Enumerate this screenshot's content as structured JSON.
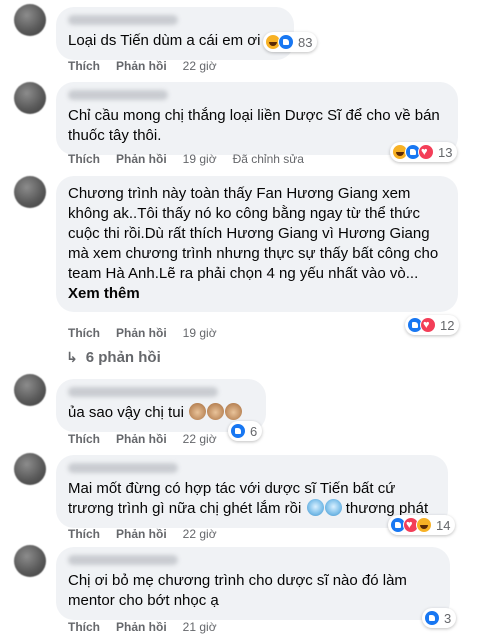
{
  "labels": {
    "like": "Thích",
    "reply": "Phản hồi",
    "see_more": "Xem thêm"
  },
  "comments": [
    {
      "text": "Loại ds Tiến dùm a cái em ơi",
      "time": "22 giờ",
      "edited": "",
      "reactions": [
        "haha",
        "like"
      ],
      "count": "83"
    },
    {
      "text": "Chỉ cầu mong chị thắng loại liền Dược Sĩ để cho về bán\nthuốc tây thôi.",
      "time": "19 giờ",
      "edited": "Đã chỉnh sửa",
      "reactions": [
        "haha",
        "like",
        "love"
      ],
      "count": "13"
    },
    {
      "text": "Chương trình này toàn thấy Fan Hương Giang xem\nkhông ak..Tôi thấy nó ko công bằng ngay từ thể thức\ncuộc thi rồi.Dù rất thích Hương Giang vì Hương Giang\nmà xem chương trình nhưng thực sự thấy bất công cho\nteam Hà Anh.Lẽ ra phải chọn 4 ng yếu nhất vào vò...",
      "time": "19 giờ",
      "edited": "",
      "reactions": [
        "like",
        "love"
      ],
      "count": "12"
    },
    {
      "text": "ủa sao vậy chị tui",
      "time": "22 giờ",
      "edited": "",
      "reactions": [
        "like"
      ],
      "count": "6"
    },
    {
      "text": "Mai mốt đừng có hợp tác với dược sĩ Tiến bất cứ\ntrương trình gì nữa chị ghét lắm rồi",
      "text_tail": "thương phát",
      "time": "22 giờ",
      "edited": "",
      "reactions": [
        "like",
        "love",
        "haha"
      ],
      "count": "14"
    },
    {
      "text": "Chị ơi bỏ mẹ chương trình cho dược sĩ nào đó làm\nmentor cho bớt nhọc ạ",
      "time": "21 giờ",
      "edited": "",
      "reactions": [
        "like"
      ],
      "count": "3"
    }
  ],
  "replies_label": "6 phản hồi"
}
